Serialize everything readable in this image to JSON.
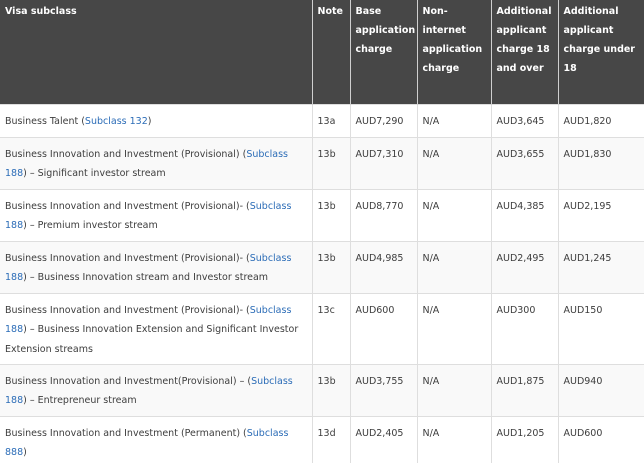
{
  "table": {
    "headers": [
      "Visa subclass",
      "Note",
      "Base application charge",
      "Non-internet application charge",
      "Additional applicant charge 18 and over",
      "Additional applicant charge under 18"
    ],
    "rows": [
      {
        "visa_prefix": "Business Talent (",
        "subclass_link": "Subclass 132",
        "visa_suffix": ")",
        "note": "13a",
        "base": "AUD7,290",
        "non_internet": "N/A",
        "additional_18_over": "AUD3,645",
        "additional_under_18": "AUD1,820"
      },
      {
        "visa_prefix": "Business Innovation and Investment (Provisional) (",
        "subclass_link": "Subclass 188",
        "visa_suffix": ") – Significant investor stream",
        "note": "13b",
        "base": "AUD7,310",
        "non_internet": "N/A",
        "additional_18_over": "AUD3,655",
        "additional_under_18": "AUD1,830"
      },
      {
        "visa_prefix": "Business Innovation and Investment (Provisional)- (",
        "subclass_link": "Subclass 188",
        "visa_suffix": ") – Premium investor stream",
        "note": "13b",
        "base": "AUD8,770",
        "non_internet": "N/A",
        "additional_18_over": "AUD4,385",
        "additional_under_18": "AUD2,195"
      },
      {
        "visa_prefix": "Business Innovation and Investment (Provisional)- (",
        "subclass_link": "Subclass 188",
        "visa_suffix": ") – Business Innovation stream and Investor stream",
        "note": "13b",
        "base": "AUD4,985",
        "non_internet": "N/A",
        "additional_18_over": "AUD2,495",
        "additional_under_18": "AUD1,245"
      },
      {
        "visa_prefix": "Business Innovation and Investment (Provisional)- (",
        "subclass_link": "Subclass 188",
        "visa_suffix": ") – Business Innovation Extension and Significant Investor Extension streams",
        "note": "13c",
        "base": "AUD600",
        "non_internet": "N/A",
        "additional_18_over": "AUD300",
        "additional_under_18": "AUD150"
      },
      {
        "visa_prefix": "Business Innovation and Investment(Provisional) – (",
        "subclass_link": "Subclass 188",
        "visa_suffix": ") – Entrepreneur stream",
        "note": "13b",
        "base": "AUD3,755",
        "non_internet": "N/A",
        "additional_18_over": "AUD1,875",
        "additional_under_18": "AUD940"
      },
      {
        "visa_prefix": "Business Innovation and Investment (Permanent) (",
        "subclass_link": "Subclass 888",
        "visa_suffix": ")",
        "note": "13d",
        "base": "AUD2,405",
        "non_internet": "N/A",
        "additional_18_over": "AUD1,205",
        "additional_under_18": "AUD600"
      }
    ]
  }
}
